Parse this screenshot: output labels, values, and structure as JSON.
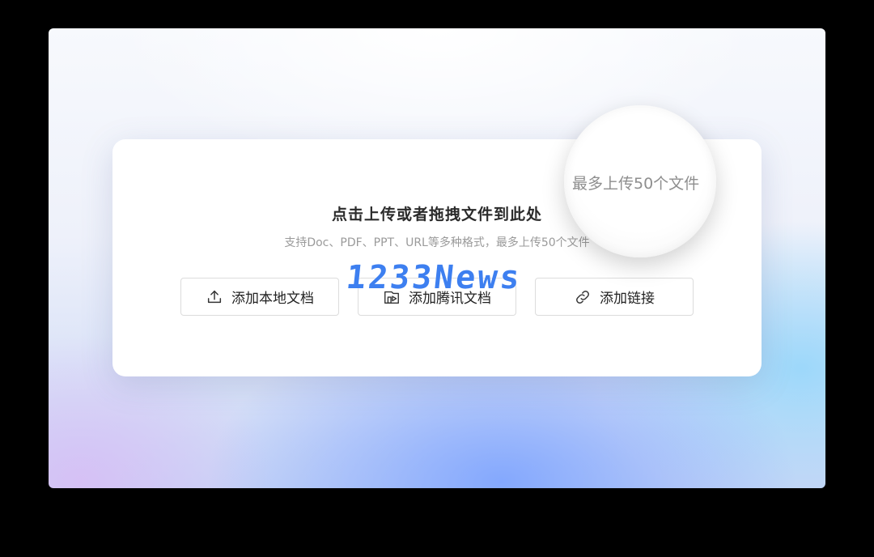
{
  "upload": {
    "title": "点击上传或者拖拽文件到此处",
    "subtitle": "支持Doc、PDF、PPT、URL等多种格式，最多上传50个文件",
    "magnifier_text": "最多上传50个文件"
  },
  "buttons": {
    "local": {
      "label": "添加本地文档",
      "icon": "upload-icon"
    },
    "tencent": {
      "label": "添加腾讯文档",
      "icon": "tencent-doc-icon"
    },
    "link": {
      "label": "添加链接",
      "icon": "link-icon"
    }
  },
  "watermark": "1233News"
}
